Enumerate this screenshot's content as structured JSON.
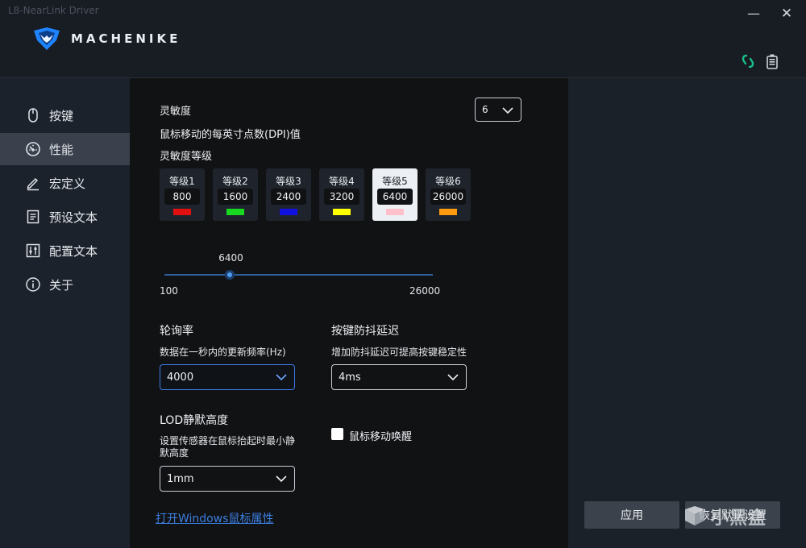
{
  "window": {
    "title": "L8-NearLink Driver",
    "minimize": "—",
    "close": "✕"
  },
  "brand": {
    "logo_text": "MACHENIKE"
  },
  "header_icons": {
    "connection": "link-icon",
    "battery": "battery-icon"
  },
  "sidebar": {
    "items": [
      {
        "label": "按键",
        "icon": "mouse-icon"
      },
      {
        "label": "性能",
        "icon": "gauge-icon",
        "active": true
      },
      {
        "label": "宏定义",
        "icon": "pen-icon"
      },
      {
        "label": "预设文本",
        "icon": "document-icon"
      },
      {
        "label": "配置文本",
        "icon": "sliders-icon"
      },
      {
        "label": "关于",
        "icon": "info-icon"
      }
    ]
  },
  "performance": {
    "sensitivity_title": "灵敏度",
    "dpi_desc": "鼠标移动的每英寸点数(DPI)值",
    "levels_count": "6",
    "levels_title": "灵敏度等级",
    "levels": [
      {
        "name": "等级1",
        "value": "800",
        "color": "#e01010"
      },
      {
        "name": "等级2",
        "value": "1600",
        "color": "#18d820"
      },
      {
        "name": "等级3",
        "value": "2400",
        "color": "#1010e0"
      },
      {
        "name": "等级4",
        "value": "3200",
        "color": "#ffff00"
      },
      {
        "name": "等级5",
        "value": "6400",
        "color": "#ffc0cb",
        "active": true
      },
      {
        "name": "等级6",
        "value": "26000",
        "color": "#ff9a10"
      }
    ],
    "slider": {
      "current": "6400",
      "min": "100",
      "max": "26000",
      "fraction": 0.244
    },
    "polling": {
      "title": "轮询率",
      "desc": "数据在一秒内的更新频率(Hz)",
      "value": "4000"
    },
    "debounce": {
      "title": "按键防抖延迟",
      "desc": "增加防抖延迟可提高按键稳定性",
      "value": "4ms"
    },
    "lod": {
      "title": "LOD静默高度",
      "desc_line1": "设置传感器在鼠标抬起时最小静",
      "desc_line2": "默高度",
      "value": "1mm"
    },
    "wake": {
      "label": "鼠标移动唤醒",
      "checked": false
    },
    "windows_link": "打开Windows鼠标属性"
  },
  "buttons": {
    "apply": "应用",
    "reset": "恢复默认设置"
  },
  "watermark": {
    "text": "小黑盒"
  }
}
